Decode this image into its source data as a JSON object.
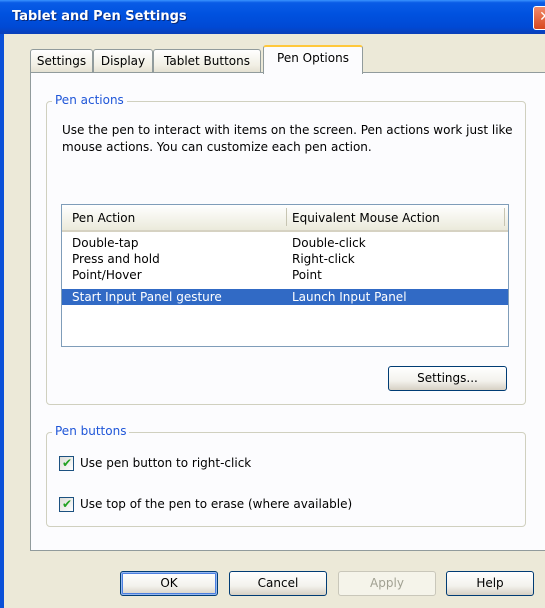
{
  "window": {
    "title": "Tablet and Pen Settings",
    "close_glyph": "✕",
    "colors": {
      "titlebar": "#0052e0",
      "selection": "#316ac5",
      "group_label": "#1f56d8",
      "checkmark": "#21a121"
    }
  },
  "tabs": [
    {
      "label": "Settings",
      "active": false
    },
    {
      "label": "Display",
      "active": false
    },
    {
      "label": "Tablet Buttons",
      "active": false
    },
    {
      "label": "Pen Options",
      "active": true
    }
  ],
  "pen_actions": {
    "group_label": "Pen actions",
    "description": "Use the pen to interact with items on the screen. Pen actions work just like mouse actions. You can customize each pen action.",
    "columns": [
      "Pen Action",
      "Equivalent Mouse Action"
    ],
    "rows": [
      {
        "action": "Double-tap",
        "mouse": "Double-click",
        "selected": false
      },
      {
        "action": "Press and hold",
        "mouse": "Right-click",
        "selected": false
      },
      {
        "action": "Point/Hover",
        "mouse": "Point",
        "selected": false
      },
      {
        "action": "Start Input Panel gesture",
        "mouse": "Launch Input Panel",
        "selected": true
      }
    ],
    "settings_button": "Settings..."
  },
  "pen_buttons": {
    "group_label": "Pen buttons",
    "right_click": {
      "label": "Use pen button to right-click",
      "checked": true
    },
    "erase": {
      "label": "Use top of the pen to erase (where available)",
      "checked": true
    },
    "check_glyph": "✔"
  },
  "buttons": {
    "ok": "OK",
    "cancel": "Cancel",
    "apply": "Apply",
    "help": "Help"
  }
}
